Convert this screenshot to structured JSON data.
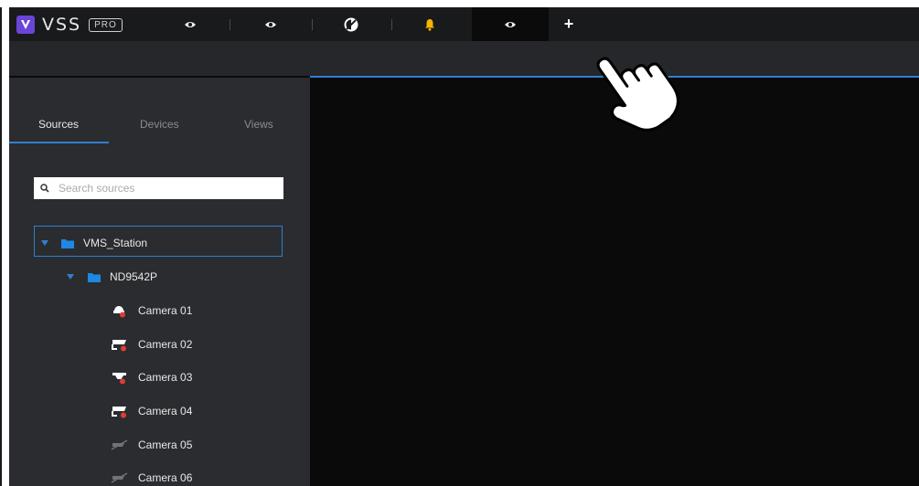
{
  "app": {
    "logo_text": "VSS",
    "logo_badge": "PRO",
    "accent": "#2f7fd0",
    "brand": "#6a45d8"
  },
  "topbar": {
    "tabs": [
      {
        "icon": "eye-icon"
      },
      {
        "icon": "eye-icon"
      },
      {
        "icon": "color-palette-icon"
      },
      {
        "icon": "bell-icon",
        "color": "#f4b400"
      },
      {
        "icon": "eye-icon",
        "active": true
      }
    ],
    "add_tab_label": "+"
  },
  "sidebar": {
    "tabs": [
      {
        "label": "Sources",
        "active": true
      },
      {
        "label": "Devices"
      },
      {
        "label": "Views"
      }
    ],
    "search": {
      "placeholder": "Search sources",
      "value": ""
    },
    "tree": {
      "station": "VMS_Station",
      "device": "ND9542P",
      "cameras": [
        {
          "label": "Camera 01",
          "icon": "dome-camera-icon",
          "status_color": "#e53935"
        },
        {
          "label": "Camera 02",
          "icon": "bullet-camera-icon",
          "status_color": "#e53935"
        },
        {
          "label": "Camera 03",
          "icon": "ceiling-camera-icon",
          "status_color": "#e53935"
        },
        {
          "label": "Camera 04",
          "icon": "bullet-camera-icon",
          "status_color": "#e53935"
        },
        {
          "label": "Camera 05",
          "icon": "camera-disabled-icon"
        },
        {
          "label": "Camera 06",
          "icon": "camera-disabled-icon"
        }
      ]
    }
  }
}
